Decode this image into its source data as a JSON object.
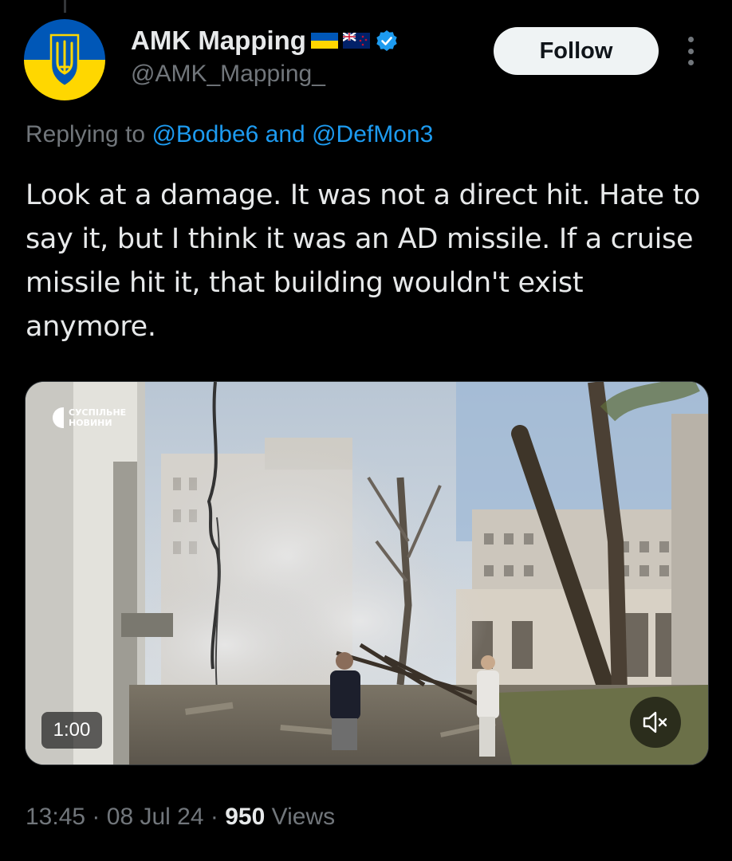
{
  "author": {
    "display_name": "AMK Mapping",
    "handle": "@AMK_Mapping_",
    "flags": [
      "ukraine-flag-icon",
      "new-zealand-flag-icon"
    ],
    "verified_icon": "verified-badge-icon",
    "avatar_icon": "ukraine-trident-emblem"
  },
  "follow_label": "Follow",
  "more_icon": "more-vertical-icon",
  "reply": {
    "prefix": "Replying to",
    "mention_1": "@Bodbe6",
    "conjunction": "and",
    "mention_2": "@DefMon3"
  },
  "tweet_text": "Look at a damage. It was not a direct hit. Hate to say it, but I think it was an AD missile. If a cruise missile hit it, that building wouldn't exist anymore.",
  "media": {
    "watermark_line1": "СУСПІЛЬНЕ",
    "watermark_line2": "НОВИНИ",
    "duration": "1:00",
    "mute_icon": "speaker-muted-icon"
  },
  "meta": {
    "time": "13:45",
    "separator": "·",
    "date": "08 Jul 24",
    "views_count": "950",
    "views_label": "Views"
  },
  "colors": {
    "background": "#000000",
    "text_primary": "#e7e9ea",
    "text_secondary": "#71767b",
    "link": "#1d9bf0",
    "verified": "#1d9bf0",
    "follow_bg": "#eff3f4"
  }
}
